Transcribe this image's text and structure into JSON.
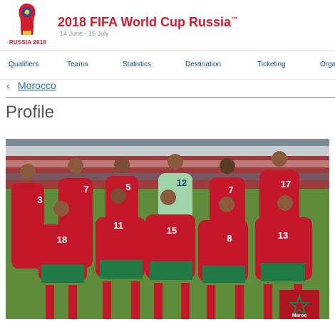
{
  "brand": {
    "logo_text": "RUSSIA 2018",
    "title": "2018 FIFA World Cup Russia",
    "trademark": "™",
    "dates": "14 June - 15 July"
  },
  "nav": {
    "items": [
      "Qualifiers",
      "Teams",
      "Statistics",
      "Destination",
      "Ticketing",
      "Orga"
    ]
  },
  "breadcrumb": {
    "back_icon": "chevron-left-icon",
    "label": "Morocco"
  },
  "page": {
    "title": "Profile"
  },
  "photo": {
    "jersey_numbers": [
      "3",
      "7",
      "5",
      "12",
      "7",
      "17",
      "18",
      "11",
      "15",
      "8",
      "13"
    ],
    "flag_text": "Maroc",
    "colors": {
      "kit_red": "#c4182a",
      "shorts_green": "#1f7a46",
      "keeper": "#9fd3a8",
      "pitch": "#5e8c3a"
    }
  },
  "colors": {
    "brand_red": "#d21b2b",
    "nav_text": "#1a4b7a",
    "link": "#1f6fb6"
  }
}
